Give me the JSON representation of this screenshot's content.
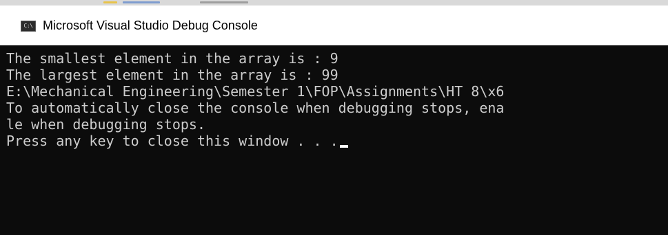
{
  "window": {
    "title": "Microsoft Visual Studio Debug Console",
    "icon": "console-app-icon",
    "icon_glyph": "C:\\"
  },
  "console": {
    "lines": [
      "The smallest element in the array is : 9",
      "The largest element in the array is : 99",
      "E:\\Mechanical Engineering\\Semester 1\\FOP\\Assignments\\HT 8\\x6",
      "To automatically close the console when debugging stops, ena",
      "le when debugging stops.",
      "Press any key to close this window . . ."
    ],
    "cursor": "blinking-underline-cursor"
  },
  "colors": {
    "background": "#0c0c0c",
    "text": "#cccccc",
    "titlebar": "#ffffff",
    "cursor": "#ffffff"
  }
}
